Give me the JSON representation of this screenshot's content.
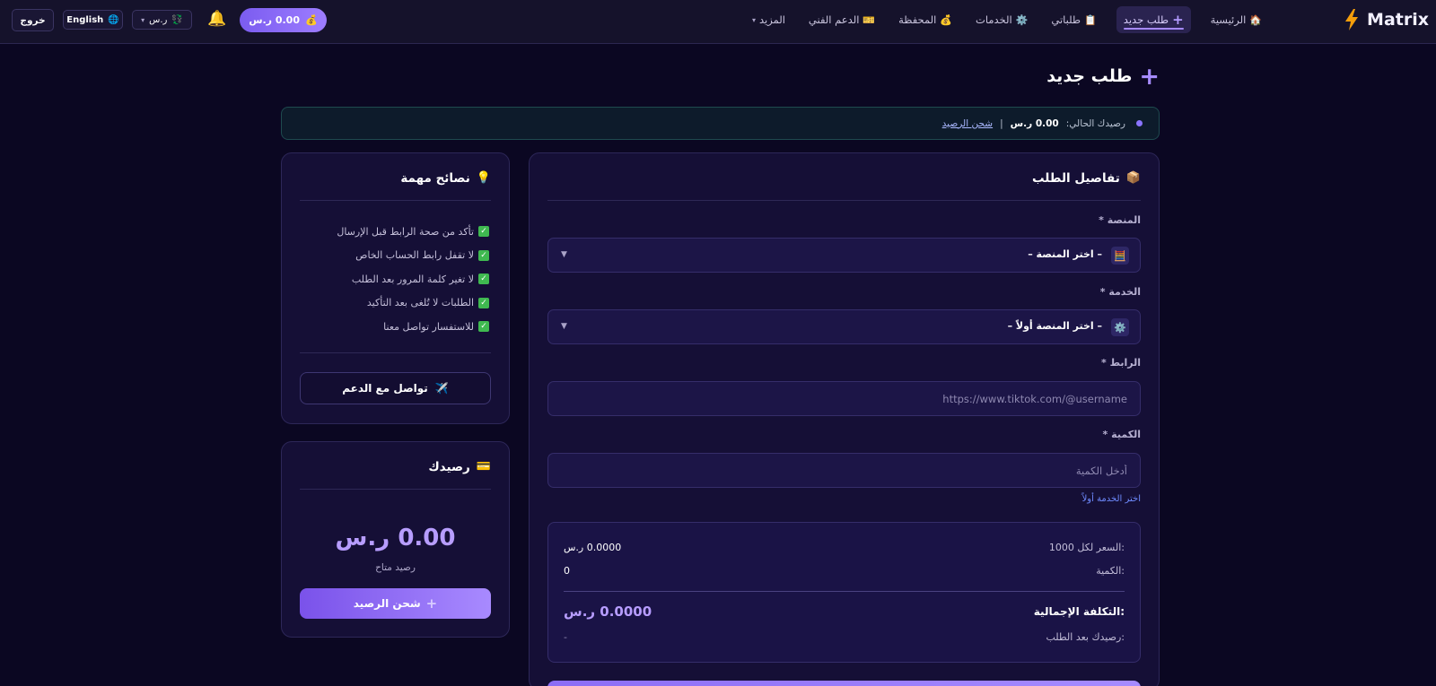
{
  "brand": {
    "name": "Matrix",
    "logo_icon": "lightning-bolt-icon",
    "accent": "#f59e0b"
  },
  "nav": {
    "items": [
      {
        "label": "الرئيسية",
        "icon": "🏠",
        "icon_name": "home-icon"
      },
      {
        "label": "طلب جديد",
        "icon": "+",
        "icon_name": "plus-icon",
        "active": true
      },
      {
        "label": "طلباتي",
        "icon": "📋",
        "icon_name": "clipboard-icon"
      },
      {
        "label": "الخدمات",
        "icon": "⚙️",
        "icon_name": "gear-icon"
      },
      {
        "label": "المحفظة",
        "icon": "💰",
        "icon_name": "money-bag-icon"
      },
      {
        "label": "الدعم الفني",
        "icon": "🎫",
        "icon_name": "ticket-icon"
      },
      {
        "label": "المزيد",
        "icon": "▾",
        "icon_name": "chevron-down-icon"
      }
    ],
    "balance_pill": "0.00 ر.س",
    "balance_icon": "💰",
    "currency": "ر.س",
    "currency_icon": "💱",
    "language": "English",
    "language_icon": "🌐",
    "logout": "خروج"
  },
  "page": {
    "title": "طلب جديد",
    "alert": {
      "prefix": "رصيدك الحالي:",
      "amount": "0.00 ر.س",
      "separator": "|",
      "link": "شحن الرصيد"
    }
  },
  "order": {
    "title": "تفاصيل الطلب",
    "title_icon": "📦",
    "platform": {
      "label": "المنصة",
      "required": "*",
      "icon": "🧮",
      "value": "– اختر المنصة –"
    },
    "service": {
      "label": "الخدمة",
      "required": "*",
      "icon": "⚙️",
      "value": "– اختر المنصة أولاً –"
    },
    "link": {
      "label": "الرابط",
      "required": "*",
      "placeholder": "https://www.tiktok.com/@username"
    },
    "quantity": {
      "label": "الكمية",
      "required": "*",
      "placeholder": "أدخل الكمية",
      "hint": "اختر الخدمة أولاً"
    },
    "summary": {
      "price_label": "السعر لكل 1000:",
      "price_value": "0.0000 ر.س",
      "qty_label": "الكمية:",
      "qty_value": "0",
      "total_label": "التكلفة الإجمالية:",
      "total_value": "0.0000 ر.س",
      "after_label": "رصيدك بعد الطلب:",
      "after_value": "-"
    }
  },
  "tips": {
    "title": "نصائح مهمة",
    "title_icon": "💡",
    "items": [
      "تأكد من صحة الرابط قبل الإرسال",
      "لا تقفل رابط الحساب الخاص",
      "لا تغير كلمة المرور بعد الطلب",
      "الطلبات لا تُلغى بعد التأكيد",
      "للاستفسار تواصل معنا"
    ],
    "check_icon": "✓",
    "support_button": "تواصل مع الدعم",
    "support_icon": "✈️"
  },
  "balance_card": {
    "title": "رصيدك",
    "title_icon": "💳",
    "amount": "0.00 ر.س",
    "subtitle": "رصيد متاح",
    "button": "شحن الرصيد",
    "button_icon": "+"
  },
  "colors": {
    "background": "#0b0722",
    "card": "#150f36",
    "accent": "#a68bff",
    "success": "#3fb950"
  }
}
